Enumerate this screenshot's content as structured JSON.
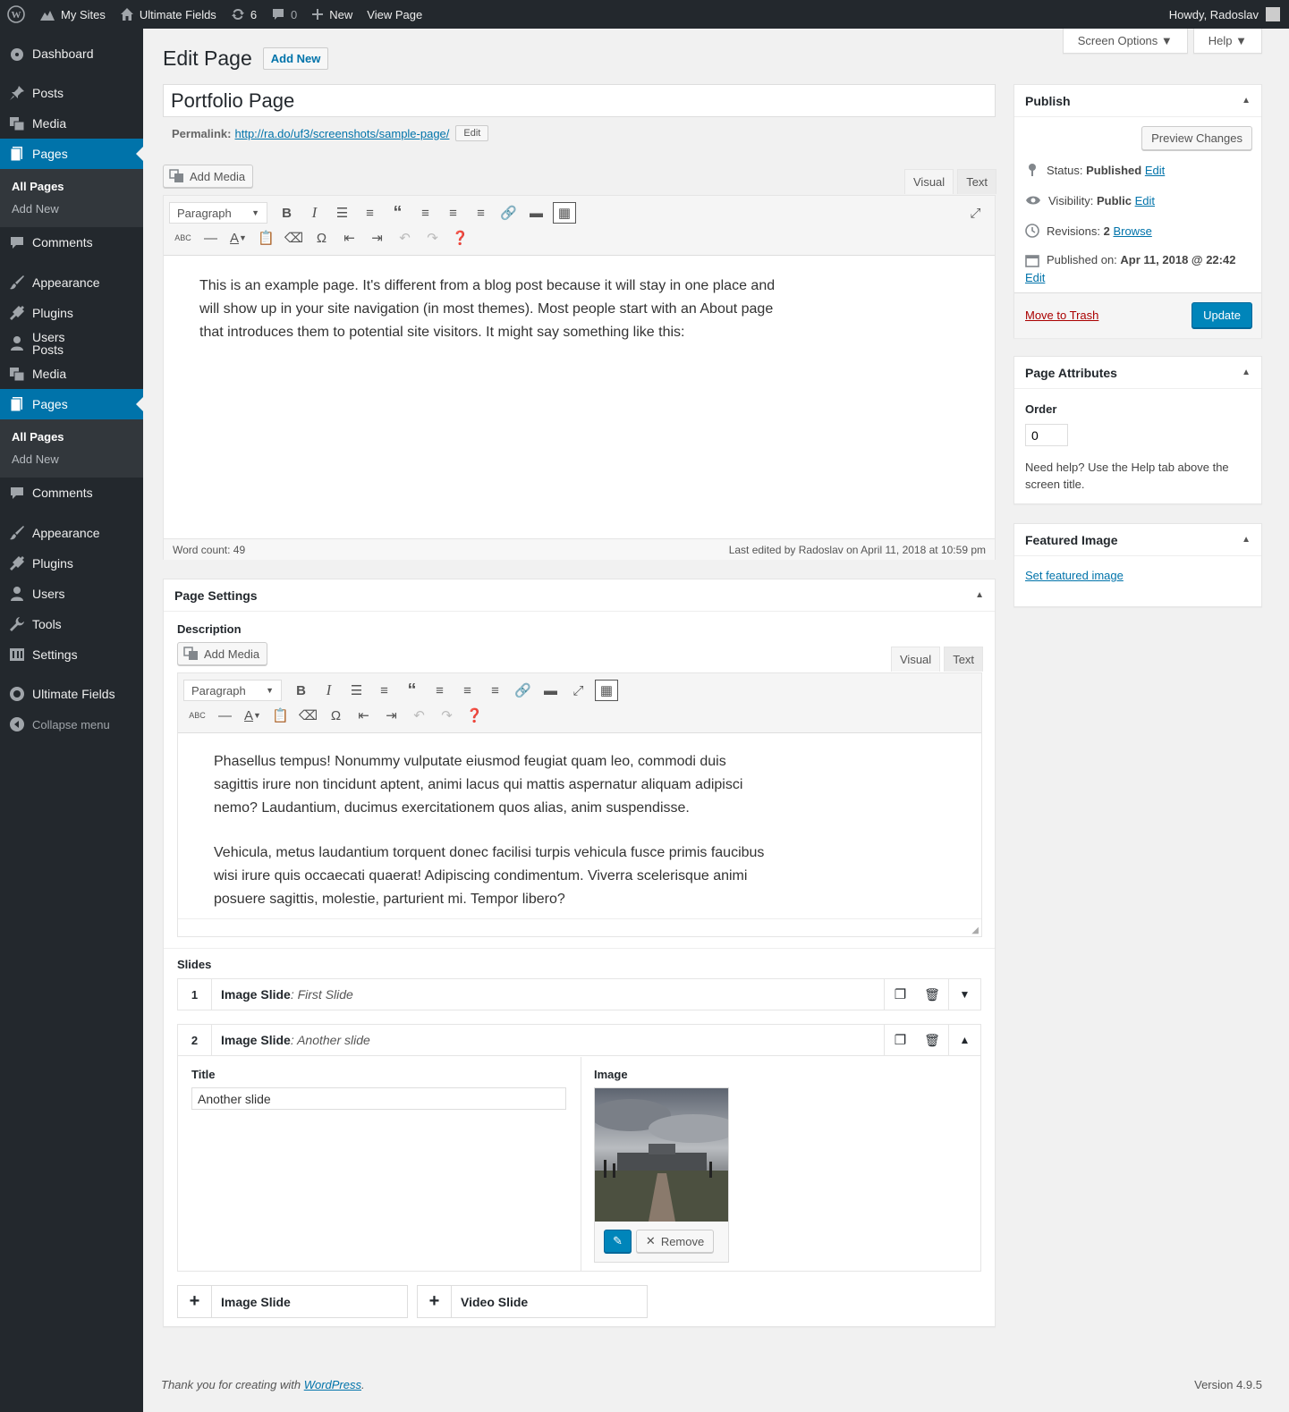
{
  "adminbar": {
    "my_sites": "My Sites",
    "site_name": "Ultimate Fields",
    "updates_count": "6",
    "comments_count": "0",
    "new_label": "New",
    "view_page": "View Page",
    "howdy": "Howdy, Radoslav"
  },
  "sidebar": {
    "items": [
      {
        "label": "Dashboard"
      },
      {
        "label": "Posts"
      },
      {
        "label": "Media"
      },
      {
        "label": "Pages"
      },
      {
        "label": "All Pages"
      },
      {
        "label": "Add New"
      },
      {
        "label": "Comments"
      },
      {
        "label": "Appearance"
      },
      {
        "label": "Plugins"
      },
      {
        "label": "Users"
      },
      {
        "label": "Posts"
      },
      {
        "label": "Media"
      },
      {
        "label": "Pages"
      },
      {
        "label": "All Pages"
      },
      {
        "label": "Add New"
      },
      {
        "label": "Comments"
      },
      {
        "label": "Appearance"
      },
      {
        "label": "Plugins"
      },
      {
        "label": "Users"
      },
      {
        "label": "Tools"
      },
      {
        "label": "Settings"
      },
      {
        "label": "Ultimate Fields"
      },
      {
        "label": "Collapse menu"
      }
    ]
  },
  "screen_meta": {
    "screen_options": "Screen Options ▼",
    "help": "Help ▼"
  },
  "header": {
    "title": "Edit Page",
    "add_new": "Add New"
  },
  "post": {
    "title": "Portfolio Page",
    "permalink_label": "Permalink:",
    "permalink_url": "http://ra.do/uf3/screenshots/sample-page/",
    "permalink_edit": "Edit"
  },
  "editor": {
    "add_media": "Add Media",
    "tab_visual": "Visual",
    "tab_text": "Text",
    "format": "Paragraph",
    "content": "This is an example page. It's different from a blog post because it will stay in one place and will show up in your site navigation (in most themes). Most people start with an About page that introduces them to potential site visitors. It might say something like this:",
    "word_count": "Word count: 49",
    "last_edited": "Last edited by Radoslav on April 11, 2018 at 10:59 pm"
  },
  "page_settings": {
    "title": "Page Settings",
    "description_label": "Description",
    "add_media": "Add Media",
    "tab_visual": "Visual",
    "tab_text": "Text",
    "format": "Paragraph",
    "para1": "Phasellus tempus! Nonummy vulputate eiusmod feugiat quam leo, commodi duis sagittis irure non tincidunt aptent, animi lacus qui mattis aspernatur aliquam adipisci nemo? Laudantium, ducimus exercitationem quos alias, anim suspendisse.",
    "para2": "Vehicula, metus laudantium torquent donec facilisi turpis vehicula fusce primis faucibus wisi irure quis occaecati quaerat! Adipiscing condimentum. Viverra scelerisque animi posuere sagittis, molestie, parturient mi. Tempor libero?",
    "slides_label": "Slides",
    "slides": [
      {
        "num": "1",
        "type": "Image Slide",
        "sep": ": ",
        "name": "First Slide"
      },
      {
        "num": "2",
        "type": "Image Slide",
        "sep": ": ",
        "name": "Another slide"
      }
    ],
    "slide_title_label": "Title",
    "slide_title_value": "Another slide",
    "slide_image_label": "Image",
    "remove_label": "Remove",
    "add_image_slide": "Image Slide",
    "add_video_slide": "Video Slide"
  },
  "publish": {
    "title": "Publish",
    "preview": "Preview Changes",
    "status_label": "Status:",
    "status_value": "Published",
    "visibility_label": "Visibility:",
    "visibility_value": "Public",
    "revisions_label": "Revisions:",
    "revisions_value": "2",
    "browse": "Browse",
    "published_on_label": "Published on:",
    "published_on_value": "Apr 11, 2018 @ 22:42",
    "edit": "Edit",
    "trash": "Move to Trash",
    "update": "Update"
  },
  "page_attributes": {
    "title": "Page Attributes",
    "order_label": "Order",
    "order_value": "0",
    "help": "Need help? Use the Help tab above the screen title."
  },
  "featured": {
    "title": "Featured Image",
    "set": "Set featured image"
  },
  "footer": {
    "thanks": "Thank you for creating with ",
    "wp": "WordPress",
    "period": ".",
    "version": "Version 4.9.5"
  }
}
